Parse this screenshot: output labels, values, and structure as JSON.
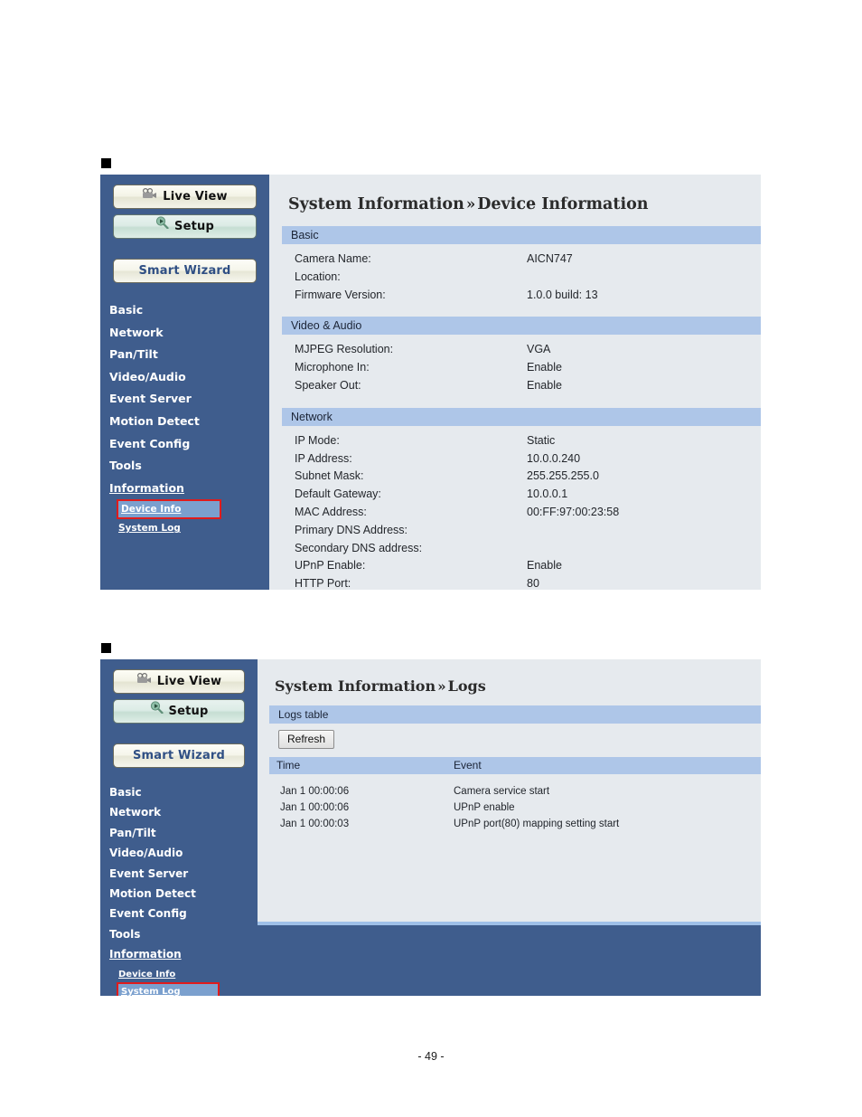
{
  "page": {
    "number": "- 49 -",
    "bullet_glyph": "■"
  },
  "nav_buttons": {
    "live_view": "Live View",
    "setup": "Setup",
    "smart_wizard": "Smart Wizard"
  },
  "sidebar": {
    "items": [
      {
        "label": "Basic"
      },
      {
        "label": "Network"
      },
      {
        "label": "Pan/Tilt"
      },
      {
        "label": "Video/Audio"
      },
      {
        "label": "Event Server"
      },
      {
        "label": "Motion Detect"
      },
      {
        "label": "Event Config"
      },
      {
        "label": "Tools"
      },
      {
        "label": "Information"
      }
    ],
    "sub_items": [
      {
        "label": "Device Info"
      },
      {
        "label": "System Log"
      }
    ]
  },
  "device_panel": {
    "title_main": "System Information",
    "title_chevron": "»",
    "title_sub": "Device Information",
    "selected_sub_item": "Device Info",
    "sections": [
      {
        "heading": "Basic",
        "rows": [
          {
            "key": "Camera Name:",
            "value": "AICN747"
          },
          {
            "key": "Location:",
            "value": ""
          },
          {
            "key": "Firmware Version:",
            "value": "1.0.0 build: 13"
          }
        ]
      },
      {
        "heading": "Video & Audio",
        "rows": [
          {
            "key": "MJPEG Resolution:",
            "value": "VGA"
          },
          {
            "key": "Microphone In:",
            "value": "Enable"
          },
          {
            "key": "Speaker Out:",
            "value": "Enable"
          }
        ]
      },
      {
        "heading": "Network",
        "rows": [
          {
            "key": "IP Mode:",
            "value": "Static"
          },
          {
            "key": "IP Address:",
            "value": "10.0.0.240"
          },
          {
            "key": "Subnet Mask:",
            "value": "255.255.255.0"
          },
          {
            "key": "Default Gateway:",
            "value": "10.0.0.1"
          },
          {
            "key": "MAC Address:",
            "value": "00:FF:97:00:23:58"
          },
          {
            "key": "Primary DNS Address:",
            "value": ""
          },
          {
            "key": "Secondary DNS address:",
            "value": ""
          },
          {
            "key": "UPnP Enable:",
            "value": "Enable"
          },
          {
            "key": "HTTP Port:",
            "value": "80"
          }
        ]
      }
    ]
  },
  "logs_panel": {
    "title_main": "System Information",
    "title_chevron": "»",
    "title_sub": "Logs",
    "selected_sub_item": "System Log",
    "section_heading": "Logs table",
    "refresh_label": "Refresh",
    "columns": {
      "time": "Time",
      "event": "Event"
    },
    "rows": [
      {
        "time": "Jan  1 00:00:06",
        "event": "Camera service start"
      },
      {
        "time": "Jan  1 00:00:06",
        "event": "UPnP enable"
      },
      {
        "time": "Jan  1 00:00:03",
        "event": "UPnP port(80) mapping setting start"
      }
    ]
  },
  "colors": {
    "sidebar_blue": "#3f5d8d",
    "content_bg": "#e6eaee",
    "section_header_blue": "#aec6e8",
    "highlight_red": "#e01b1b",
    "selected_item_blue": "#7ba0ce"
  }
}
